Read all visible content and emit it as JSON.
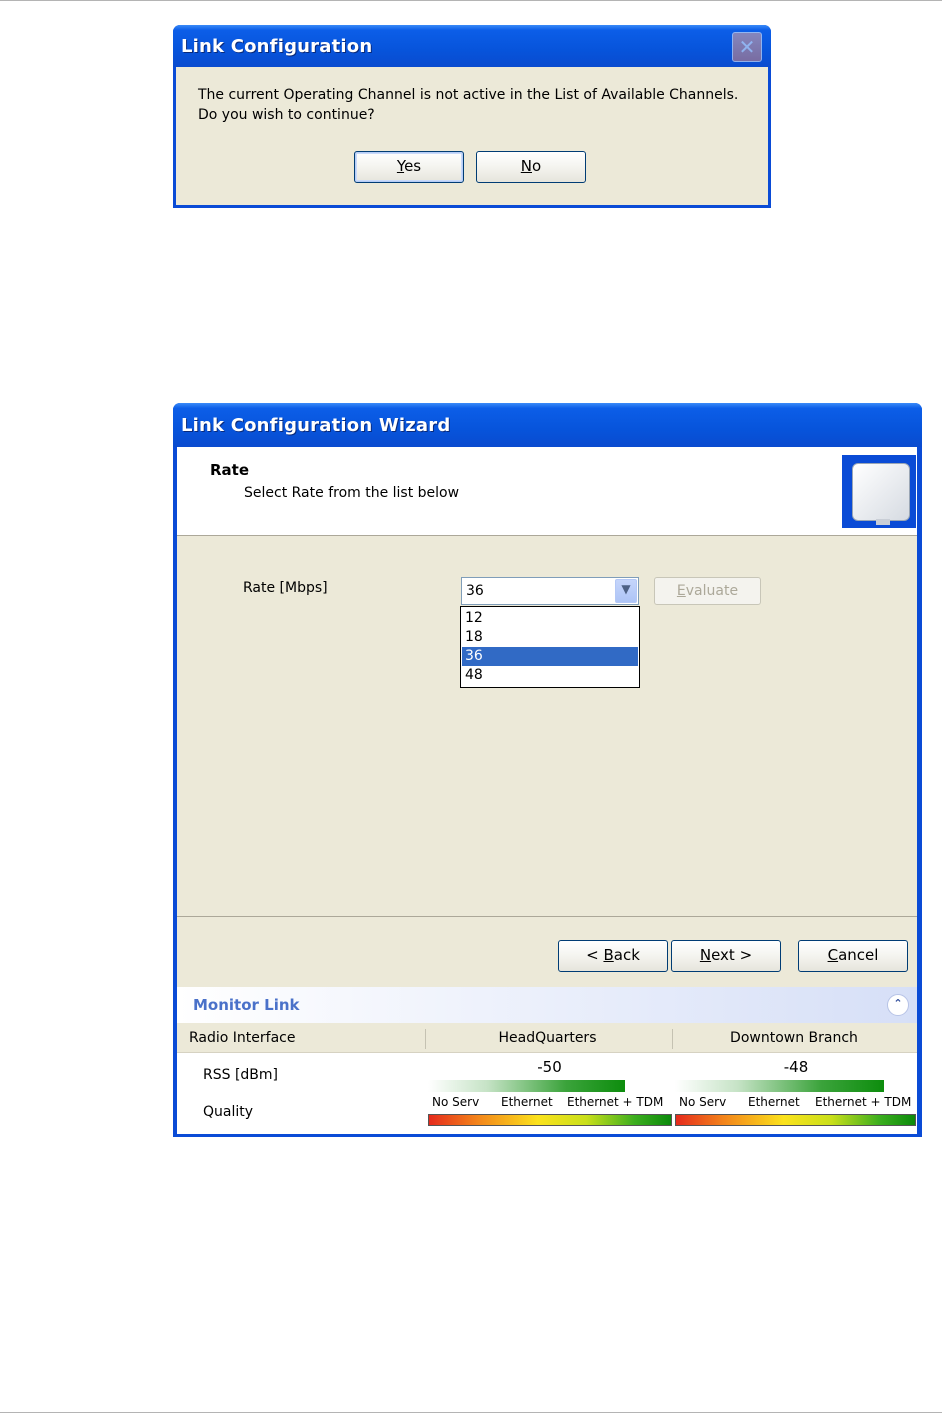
{
  "dialog": {
    "title": "Link Configuration",
    "close_icon": "close-icon",
    "message_line1": "The current Operating Channel is not active in the List of Available Channels.",
    "message_line2": "Do you wish to continue?",
    "yes_accel": "Y",
    "yes_rest": "es",
    "no_accel": "N",
    "no_rest": "o"
  },
  "wizard": {
    "title": "Link Configuration Wizard",
    "header": {
      "title": "Rate",
      "subtitle": "Select Rate from the list below",
      "icon": "antenna-icon"
    },
    "rate_label": "Rate [Mbps]",
    "rate_selected": "36",
    "rate_options": [
      "12",
      "18",
      "36",
      "48"
    ],
    "evaluate_accel": "E",
    "evaluate_rest": "valuate",
    "back_pre": "< ",
    "back_accel": "B",
    "back_rest": "ack",
    "next_accel": "N",
    "next_rest": "ext >",
    "cancel_accel": "C",
    "cancel_rest": "ancel"
  },
  "monitor": {
    "title": "Monitor Link",
    "collapse_icon": "collapse-chevron-icon",
    "columns": [
      "Radio Interface",
      "HeadQuarters",
      "Downtown Branch"
    ],
    "rows": [
      "RSS [dBm]",
      "Quality"
    ],
    "hq": {
      "rss": "-50"
    },
    "branch": {
      "rss": "-48"
    },
    "quality_labels": [
      "No Serv",
      "Ethernet",
      "Ethernet + TDM"
    ]
  }
}
